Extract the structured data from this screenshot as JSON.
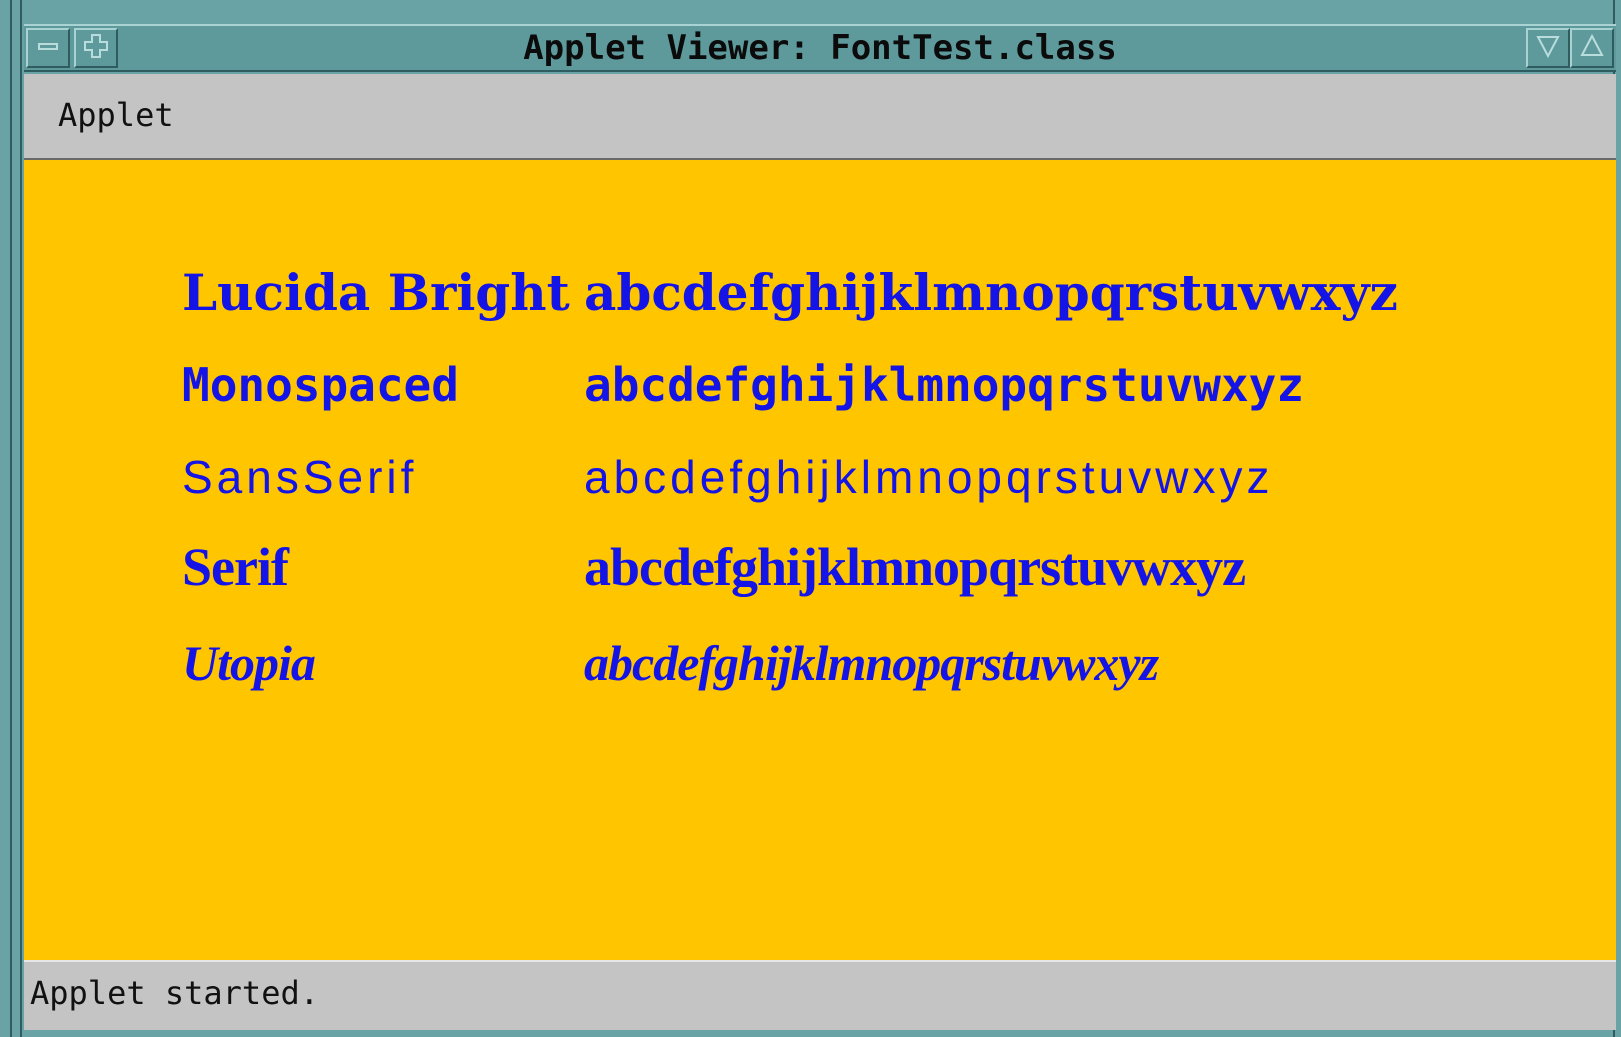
{
  "window": {
    "title": "Applet Viewer: FontTest.class",
    "controls": {
      "minimize_icon": "minus-icon",
      "restore_icon": "plus-icon",
      "lower_icon": "triangle-down-icon",
      "raise_icon": "triangle-up-icon"
    },
    "colors": {
      "frame": "#69a3a6",
      "canvas_bg": "#ffc600",
      "text": "#1414e6",
      "chrome": "#c4c4c4"
    }
  },
  "menubar": {
    "items": [
      {
        "label": "Applet"
      }
    ]
  },
  "fonts": [
    {
      "name": "Lucida Bright",
      "sample": "abcdefghijklmnopqrstuvwxyz"
    },
    {
      "name": "Monospaced",
      "sample": "abcdefghijklmnopqrstuvwxyz"
    },
    {
      "name": "SansSerif",
      "sample": "abcdefghijklmnopqrstuvwxyz"
    },
    {
      "name": "Serif",
      "sample": "abcdefghijklmnopqrstuvwxyz"
    },
    {
      "name": "Utopia",
      "sample": "abcdefghijklmnopqrstuvwxyz"
    }
  ],
  "statusbar": {
    "text": "Applet started."
  }
}
